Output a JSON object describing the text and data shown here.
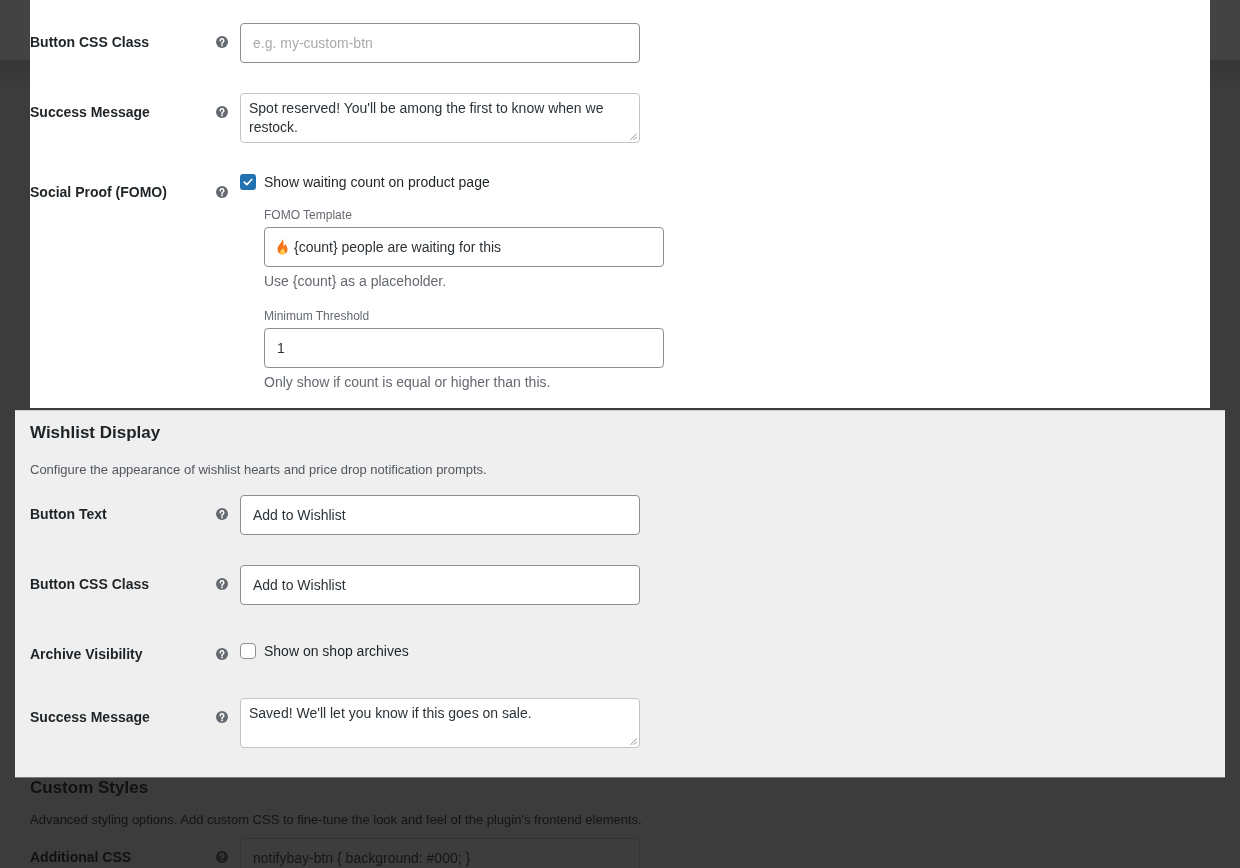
{
  "panel": {
    "rows": [
      {
        "kind": "text",
        "label": "Button CSS Class",
        "placeholder": "e.g. my-custom-btn"
      },
      {
        "kind": "textarea",
        "label": "Success Message",
        "value": "Spot reserved! You'll be among the first to know when we restock."
      },
      {
        "kind": "checkbox",
        "label": "Social Proof (FOMO)",
        "checkbox_label": "Show waiting count on product page",
        "checked": true,
        "subfields": [
          {
            "kind": "prefixed",
            "label": "FOMO Template",
            "value": "{count} people are waiting for this",
            "hint": "Use {count} as a placeholder."
          },
          {
            "kind": "plain",
            "label": "Minimum Threshold",
            "value": "1",
            "hint": "Only show if count is equal or higher than this."
          }
        ]
      }
    ]
  },
  "wishlist_display": {
    "title": "Wishlist Display",
    "description": "Configure the appearance of wishlist hearts and price drop notification prompts.",
    "rows": [
      {
        "kind": "text",
        "label": "Button Text",
        "value": "Add to Wishlist"
      },
      {
        "kind": "text",
        "label": "Button CSS Class",
        "value": "Add to Wishlist"
      },
      {
        "kind": "checkbox",
        "label": "Archive Visibility",
        "checkbox_label": "Show on shop archives",
        "checked": false
      },
      {
        "kind": "textarea",
        "label": "Success Message",
        "value": "Saved! We'll let you know if this goes on sale."
      }
    ]
  },
  "custom_styles": {
    "title": "Custom Styles",
    "description": "Advanced styling options. Add custom CSS to fine-tune the look and feel of the plugin's frontend elements.",
    "rows": [
      {
        "kind": "text",
        "label": "Additional CSS",
        "placeholder": "notifybay-btn { background: #000; }"
      }
    ]
  }
}
